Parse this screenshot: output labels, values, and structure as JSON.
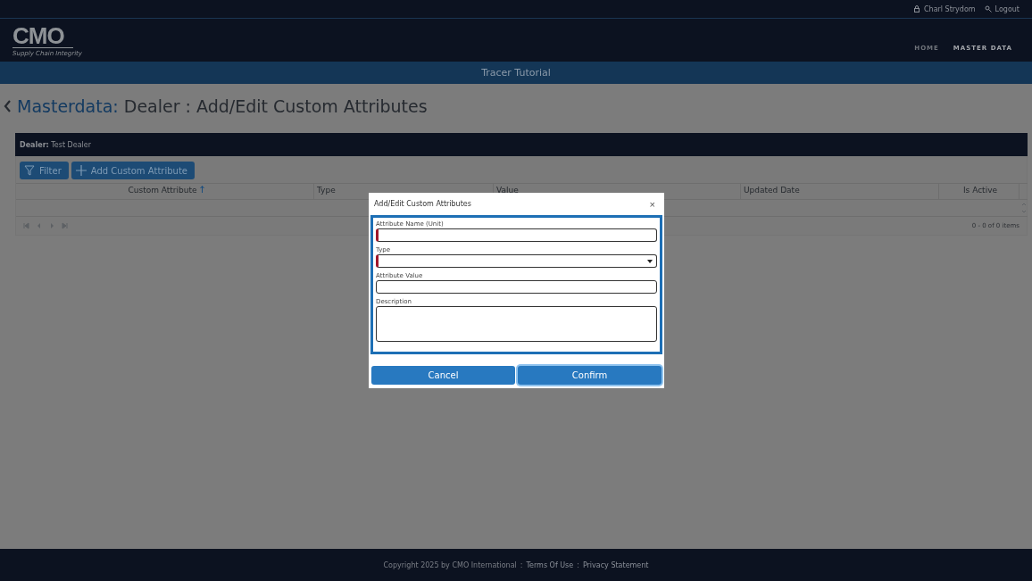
{
  "top_bar": {
    "user": "Charl Strydom",
    "logout": "Logout"
  },
  "header": {
    "logo": "CMO",
    "tagline": "Supply Chain Integrity",
    "nav": [
      {
        "label": "HOME",
        "selected": false
      },
      {
        "label": "MASTER DATA",
        "selected": true
      }
    ]
  },
  "banner": {
    "title": "Tracer Tutorial"
  },
  "page_title": {
    "section": "Masterdata:",
    "title": "Dealer : Add/Edit Custom Attributes"
  },
  "dealer_bar": {
    "text": "**Dealer:** Test Dealer"
  },
  "toolbar": [
    {
      "kind": "filter",
      "label": "Filter"
    },
    {
      "kind": "add",
      "label": "Add Custom Attribute"
    }
  ],
  "table": {
    "columns": [
      {
        "label": "Custom Attribute",
        "sorted": true
      },
      {
        "label": "Type",
        "sorted": false
      },
      {
        "label": "Value",
        "sorted": false
      },
      {
        "label": "Updated Date",
        "sorted": false
      },
      {
        "label": "Is Active",
        "sorted": false
      }
    ],
    "pager": {
      "summary": "0 - 0 of 0 items"
    }
  },
  "modal": {
    "title": "Add/Edit Custom Attributes",
    "close": "×",
    "fields": [
      {
        "kind": "text",
        "label": "Attribute Name (Unit)",
        "required": true
      },
      {
        "kind": "select",
        "label": "Type",
        "required": true
      },
      {
        "kind": "text",
        "label": "Attribute Value",
        "required": false
      },
      {
        "kind": "textarea",
        "label": "Description",
        "required": false
      }
    ],
    "buttons": [
      {
        "label": "Cancel",
        "focused": false
      },
      {
        "label": "Confirm",
        "focused": true
      }
    ]
  },
  "footer": {
    "parts": [
      {
        "kind": "text",
        "text": "Copyright 2025 by CMO International"
      },
      {
        "kind": "sep",
        "text": ":"
      },
      {
        "kind": "link",
        "text": "Terms Of Use"
      },
      {
        "kind": "sep",
        "text": ":"
      },
      {
        "kind": "link",
        "text": "Privacy Statement"
      }
    ]
  }
}
